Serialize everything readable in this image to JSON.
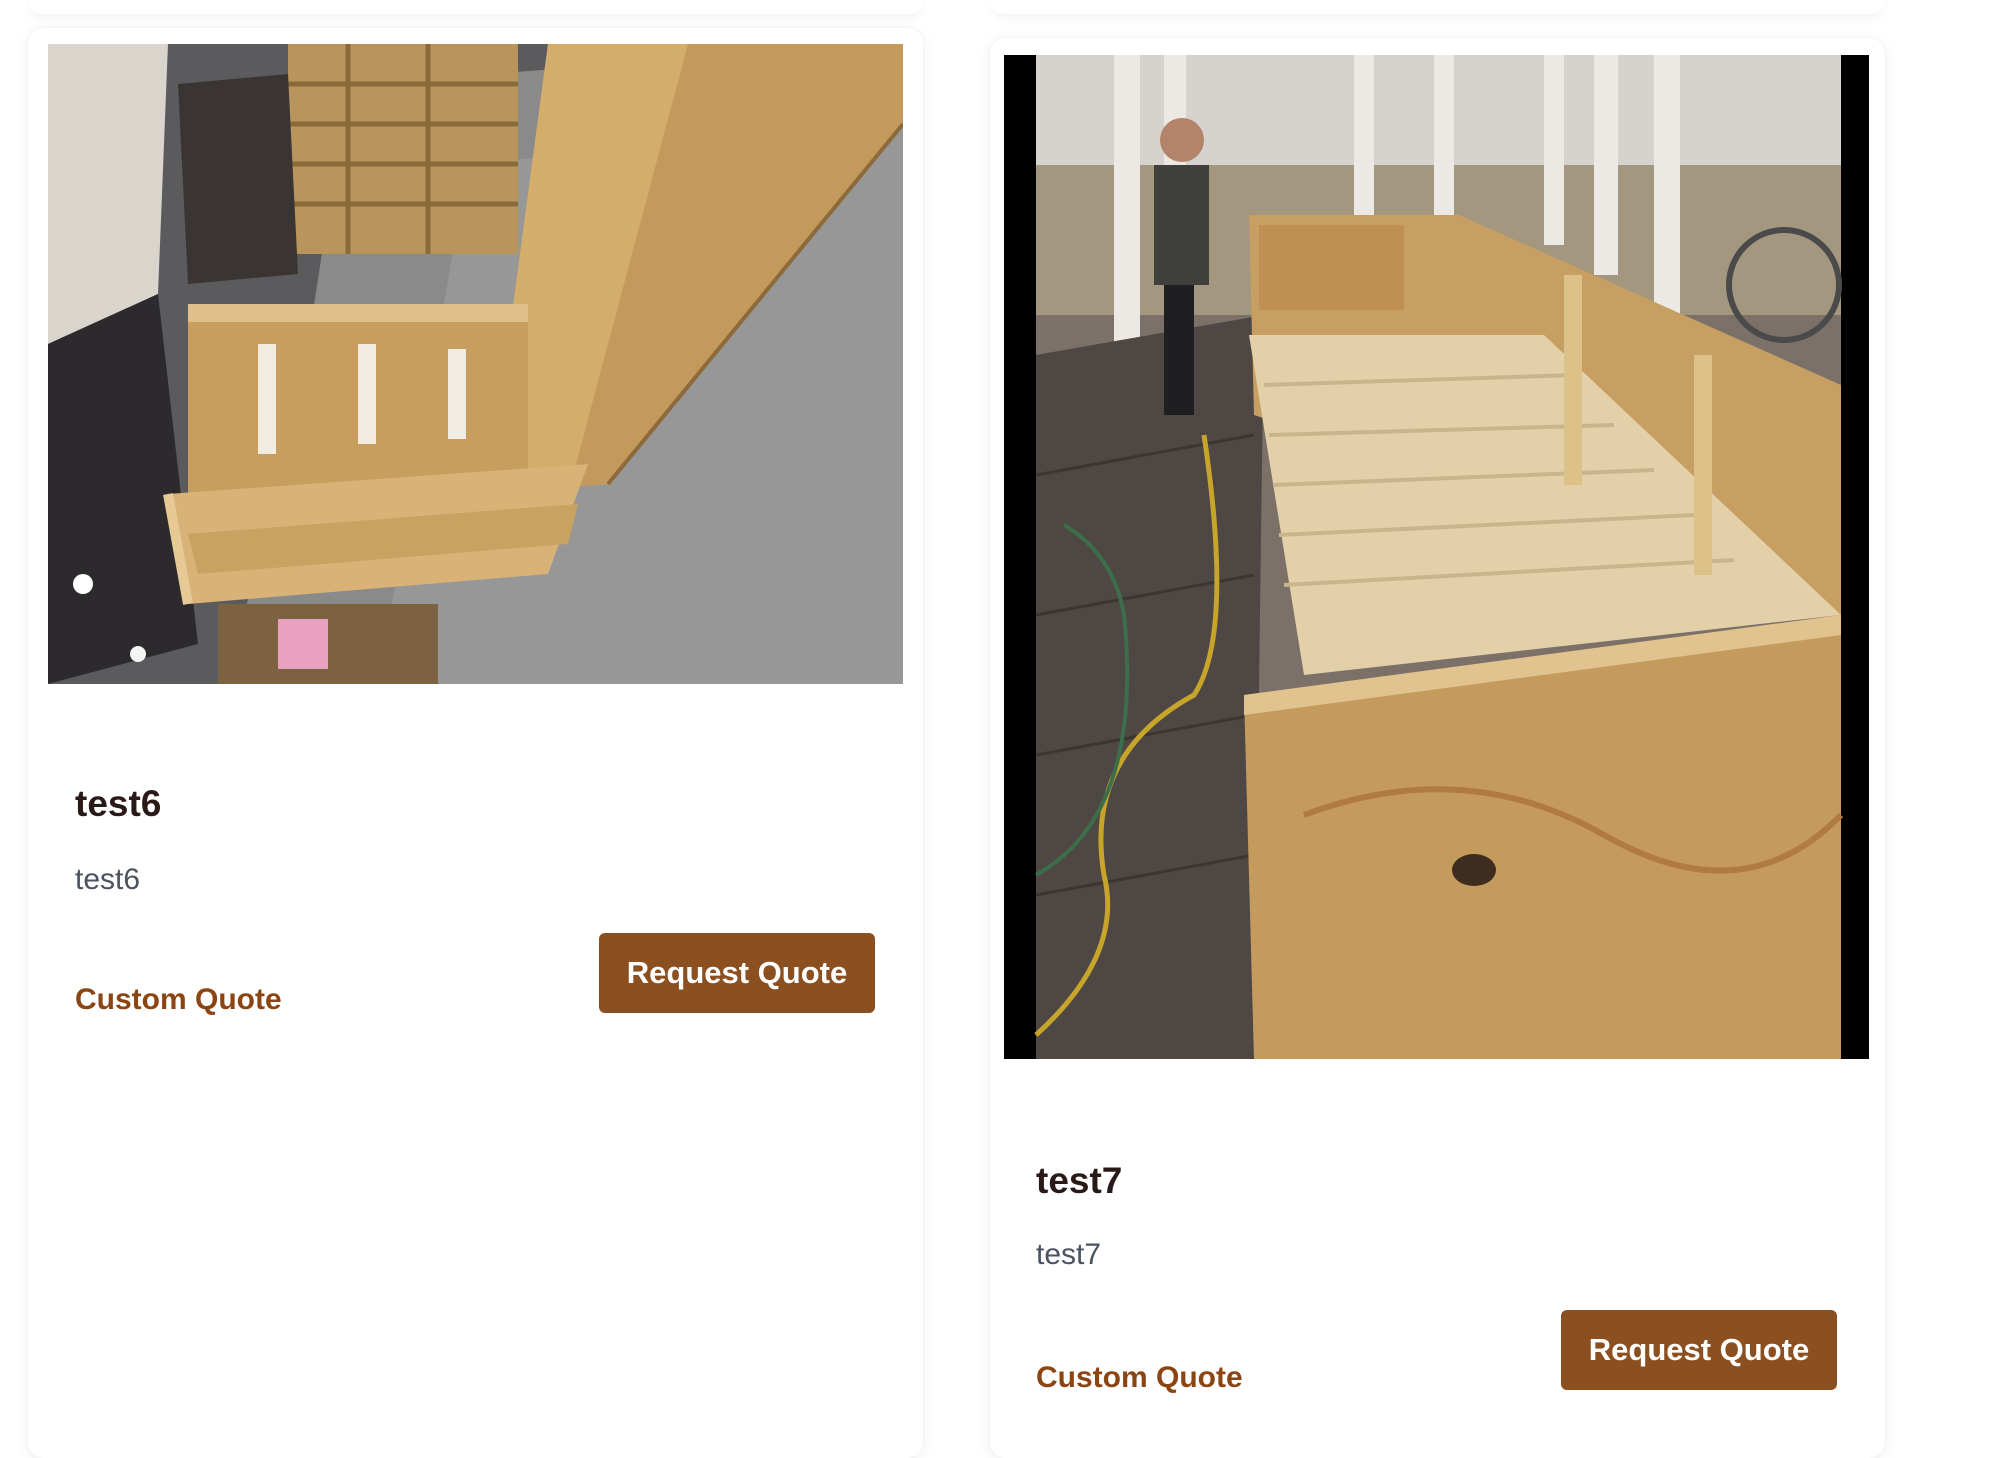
{
  "products": [
    {
      "title": "test6",
      "description": "test6",
      "image_alt": "Open plywood crate in warehouse",
      "custom_quote_label": "Custom Quote",
      "request_button_label": "Request Quote"
    },
    {
      "title": "test7",
      "description": "test7",
      "image_alt": "Long open plywood crate in workshop",
      "custom_quote_label": "Custom Quote",
      "request_button_label": "Request Quote"
    }
  ],
  "colors": {
    "accent": "#8b4513",
    "button_bg": "#8b4f20",
    "title": "#2a1a17",
    "description": "#4b5361"
  }
}
